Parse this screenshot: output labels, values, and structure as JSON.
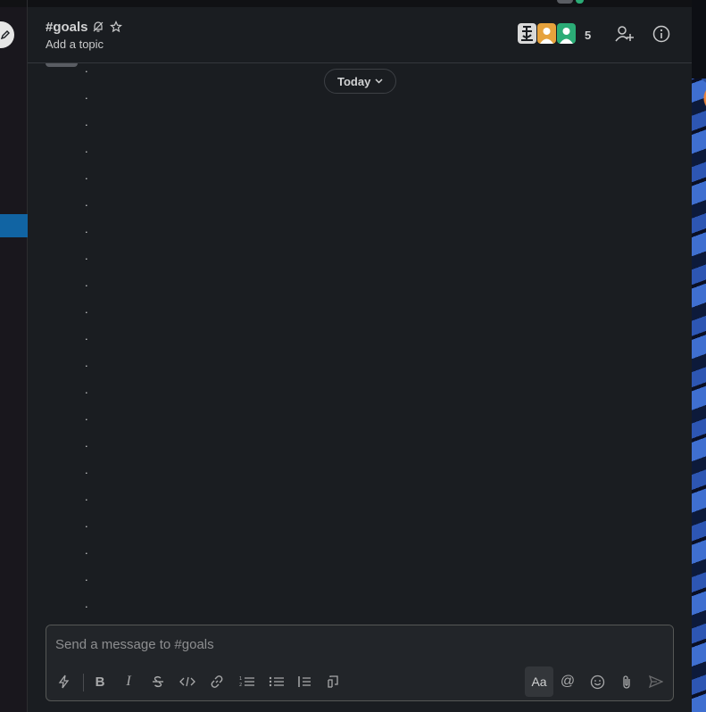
{
  "channel": {
    "name": "#goals",
    "topic": "Add a topic",
    "member_count": "5"
  },
  "messages": {
    "day_divider": "Today",
    "dot_lines": [
      ".",
      ".",
      ".",
      ".",
      ".",
      ".",
      ".",
      ".",
      ".",
      ".",
      ".",
      ".",
      ".",
      ".",
      ".",
      ".",
      ".",
      ".",
      ".",
      ".",
      "."
    ]
  },
  "composer": {
    "placeholder": "Send a message to #goals",
    "format_toggle_label": "Aa",
    "mention_label": "@"
  },
  "colors": {
    "accent": "#1164a3",
    "online": "#2bac76"
  }
}
